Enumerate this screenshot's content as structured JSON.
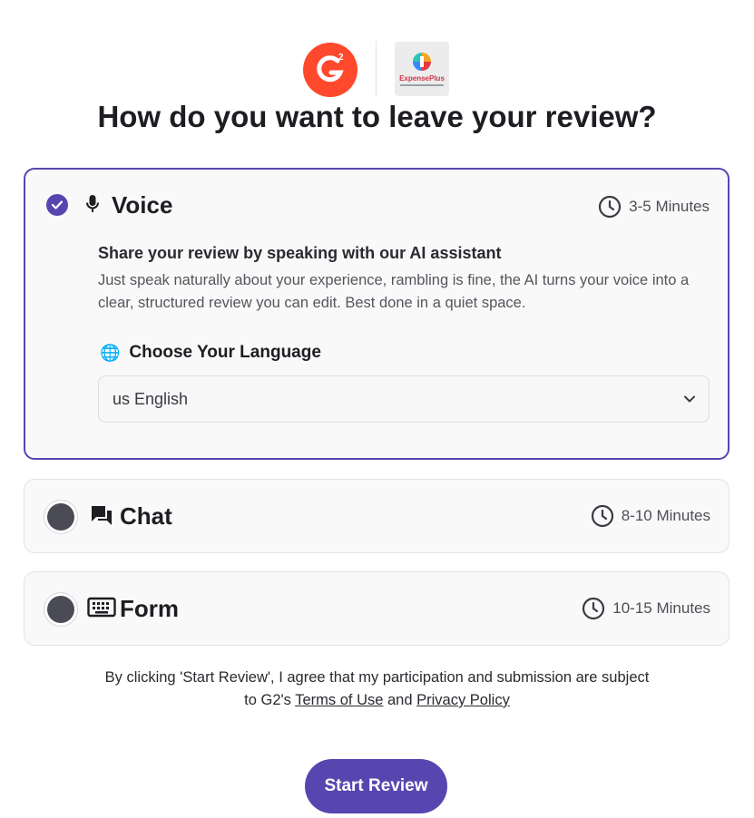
{
  "logos": {
    "g2_text": "2",
    "vendor_name": "ExpensePlus"
  },
  "title": "How do you want to leave your review?",
  "options": [
    {
      "key": "voice",
      "label": "Voice",
      "time": "3-5 Minutes",
      "selected": true,
      "icon": "microphone-icon",
      "description_title": "Share your review by speaking with our AI assistant",
      "description": "Just speak naturally about your experience, rambling is fine, the AI turns your voice into a clear, structured review you can edit. Best done in a quiet space.",
      "language_label": "Choose Your Language",
      "language_value": "us English"
    },
    {
      "key": "chat",
      "label": "Chat",
      "time": "8-10 Minutes",
      "selected": false,
      "icon": "chat-icon"
    },
    {
      "key": "form",
      "label": "Form",
      "time": "10-15 Minutes",
      "selected": false,
      "icon": "keyboard-icon"
    }
  ],
  "consent": {
    "line1": "By clicking 'Start Review', I agree that my participation and submission are subject",
    "line2_prefix": "to G2's",
    "terms": "Terms of Use",
    "and": "and",
    "privacy": "Privacy Policy"
  },
  "start_button": "Start Review",
  "colors": {
    "accent": "#5746af",
    "g2_brand": "#ff492c"
  }
}
